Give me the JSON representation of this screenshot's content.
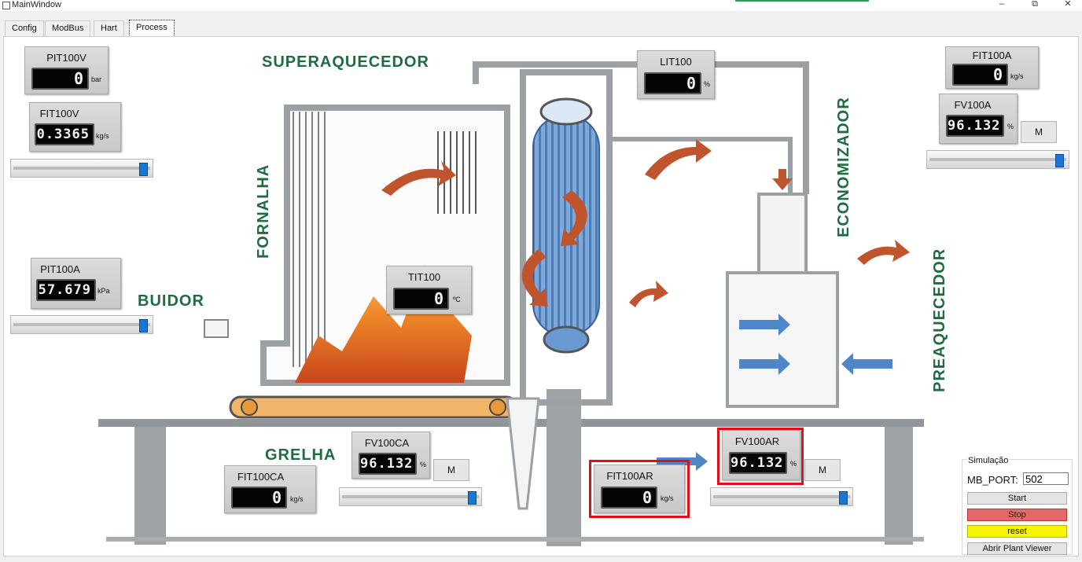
{
  "window": {
    "title": "MainWindow"
  },
  "tabs": [
    {
      "label": "Config"
    },
    {
      "label": "ModBus"
    },
    {
      "label": "Hart"
    },
    {
      "label": "Process"
    }
  ],
  "diagram_labels": {
    "superaquecedor": "SUPERAQUECEDOR",
    "fornalha": "FORNALHA",
    "economizador": "ECONOMIZADOR",
    "preaquecedor": "PREAQUECEDOR",
    "distribuidor": "BUIDOR",
    "grelha": "GRELHA"
  },
  "gauges": {
    "pit100v": {
      "label": "PIT100V",
      "value": "0",
      "unit": "bar"
    },
    "fit100v": {
      "label": "FIT100V",
      "value": "0.3365",
      "unit": "kg/s"
    },
    "pit100a": {
      "label": "PIT100A",
      "value": "57.679",
      "unit": "kPa"
    },
    "tit100": {
      "label": "TIT100",
      "value": "0",
      "unit": "ºC"
    },
    "lit100": {
      "label": "LIT100",
      "value": "0",
      "unit": "%"
    },
    "fit100a": {
      "label": "FIT100A",
      "value": "0",
      "unit": "kg/s"
    },
    "fv100a": {
      "label": "FV100A",
      "value": "96.132",
      "unit": "%"
    },
    "fv100ca": {
      "label": "FV100CA",
      "value": "96.132",
      "unit": "%"
    },
    "fit100ca": {
      "label": "FIT100CA",
      "value": "0",
      "unit": "kg/s"
    },
    "fit100ar": {
      "label": "FIT100AR",
      "value": "0",
      "unit": "kg/s"
    },
    "fv100ar": {
      "label": "FV100AR",
      "value": "96.132",
      "unit": "%"
    }
  },
  "sliders": {
    "fit100v": {
      "level": 0.98
    },
    "pit100a": {
      "level": 0.98
    },
    "fv100a": {
      "level": 0.98
    },
    "fv100ca": {
      "level": 0.98
    },
    "fv100ar": {
      "level": 0.98
    }
  },
  "buttons": {
    "manual_label": "M"
  },
  "simulation": {
    "group_title": "Simulação",
    "port_label": "MB_PORT:",
    "port_value": "502",
    "start_label": "Start",
    "stop_label": "Stop",
    "reset_label": "reset",
    "viewer_label": "Abrir Plant Viewer"
  },
  "colors": {
    "accent": "#1976d2",
    "stop": "#e36868",
    "reset": "#f6f600",
    "highlight": "#e0101a",
    "diagram_text": "#1f6b42"
  }
}
